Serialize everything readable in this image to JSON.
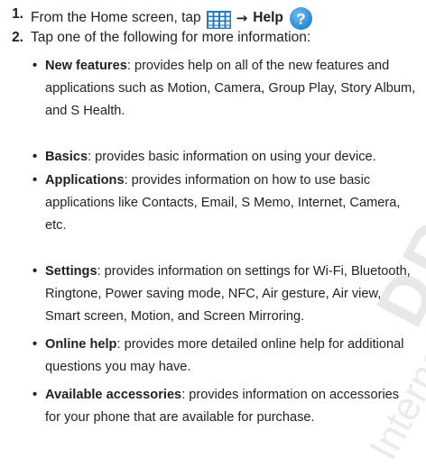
{
  "watermark": {
    "word1": "DRAFT",
    "word2": "Internal"
  },
  "steps": [
    {
      "number": "1.",
      "text_before": "From the Home screen, tap",
      "icon1": "apps-grid-icon",
      "arrow": "→",
      "target": "Help",
      "icon2": "help-question-icon"
    },
    {
      "number": "2.",
      "text": "Tap one of the following for more information:"
    }
  ],
  "bullets": [
    {
      "term": "New features",
      "lines": [
        ": provides help on all of the new features and",
        "applications such as Motion, Camera, Group Play, Story Album,",
        "and S Health."
      ]
    },
    {
      "term": "Basics",
      "lines": [
        ": provides basic information on using your device."
      ]
    },
    {
      "term": "Applications",
      "lines": [
        ": provides information on how to use basic",
        "applications like Contacts, Email, S Memo, Internet, Camera,",
        "etc."
      ]
    },
    {
      "term": "Settings",
      "lines": [
        ": provides information on settings for Wi-Fi, Bluetooth,",
        "Ringtone, Power saving mode, NFC, Air gesture, Air view,",
        "Smart screen, Motion, and Screen Mirroring."
      ]
    },
    {
      "term": "Online help",
      "lines": [
        ": provides more detailed online help for additional",
        "questions you may have."
      ]
    },
    {
      "term": "Available accessories",
      "lines": [
        ": provides information on accessories",
        "for your phone that are available for purchase."
      ]
    }
  ],
  "colors": {
    "text": "#231f20",
    "grid_icon": "#1a7bd0",
    "help_icon": "#2a8ad9",
    "watermark": "#e6e6e6"
  }
}
